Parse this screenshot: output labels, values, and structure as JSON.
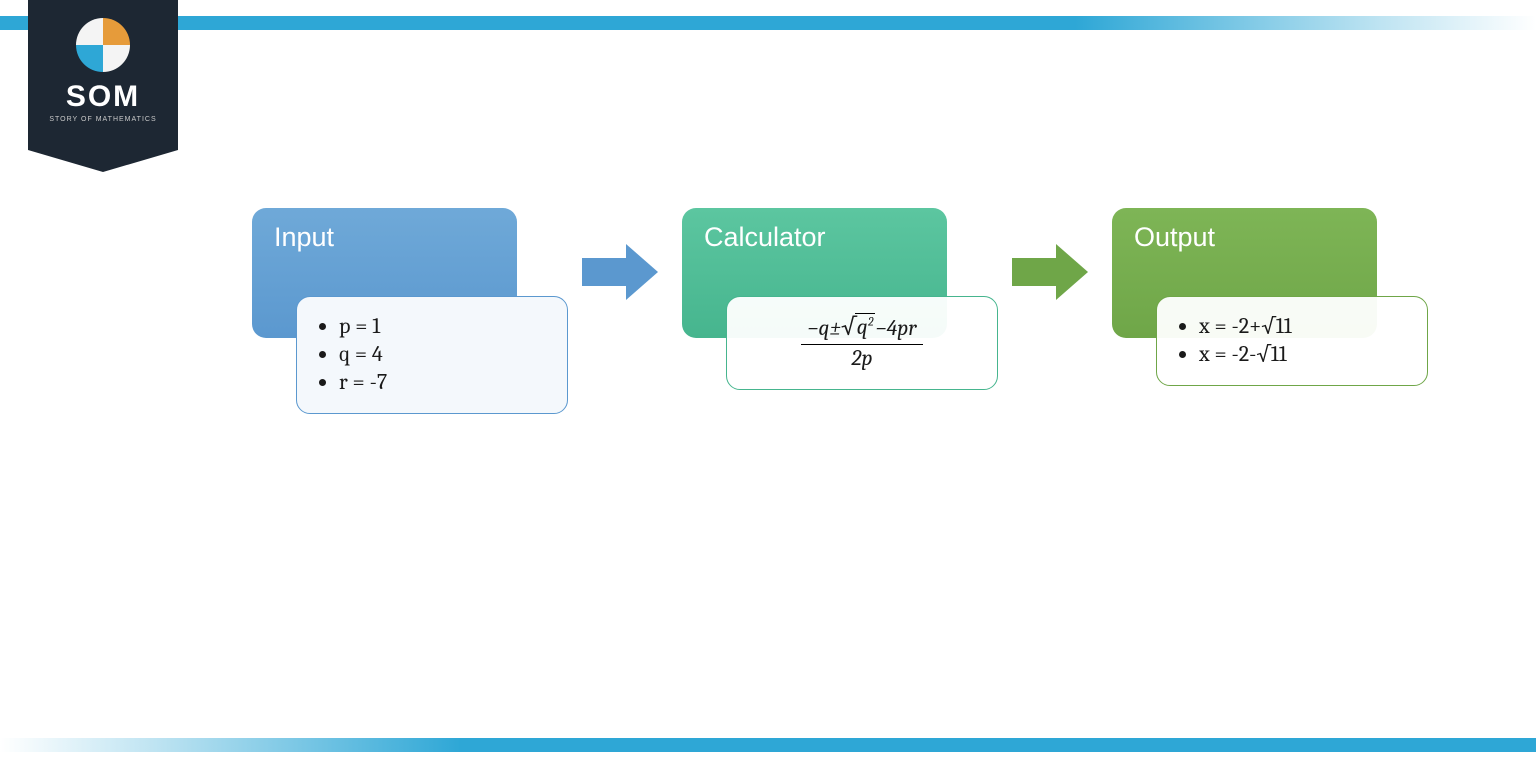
{
  "logo": {
    "name": "SOM",
    "subtitle": "STORY OF MATHEMATICS"
  },
  "stages": {
    "input": {
      "title": "Input",
      "items": [
        "p = 1",
        "q = 4",
        "r = -7"
      ]
    },
    "calculator": {
      "title": "Calculator",
      "formula": {
        "numerator": "−q±√(q²)−4pr",
        "denominator": "2p"
      }
    },
    "output": {
      "title": "Output",
      "items": [
        "x = -2+√11",
        "x = -2-√11"
      ]
    }
  }
}
